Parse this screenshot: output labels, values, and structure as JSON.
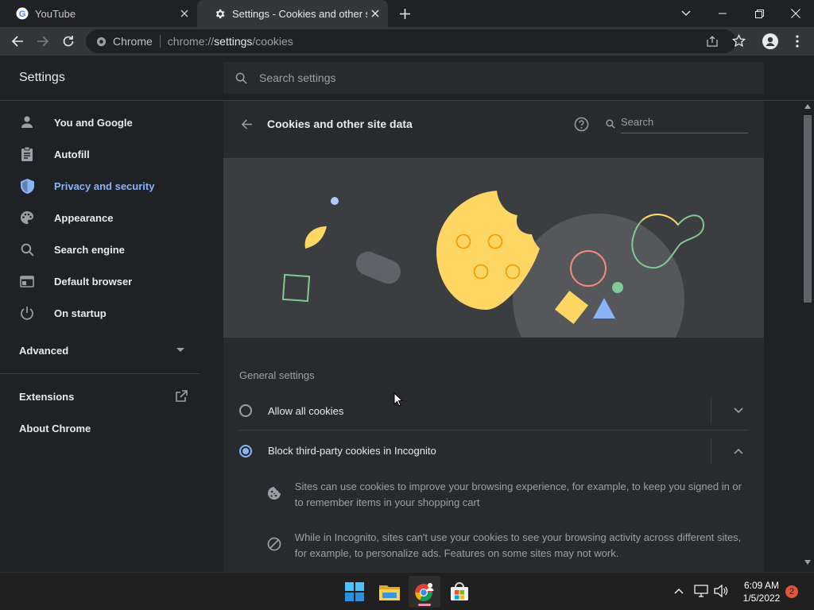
{
  "tabs": [
    {
      "title": "YouTube",
      "icon": "google-g-icon"
    },
    {
      "title": "Settings - Cookies and other site data",
      "icon": "gear-icon",
      "active": true
    }
  ],
  "toolbar": {
    "site_chip": "Chrome",
    "url_prefix": "chrome://",
    "url_host": "settings",
    "url_path": "/cookies"
  },
  "settings": {
    "title": "Settings",
    "search_placeholder": "Search settings"
  },
  "sidebar": {
    "items": [
      {
        "label": "You and Google",
        "icon": "person-icon"
      },
      {
        "label": "Autofill",
        "icon": "clipboard-icon"
      },
      {
        "label": "Privacy and security",
        "icon": "shield-icon",
        "active": true
      },
      {
        "label": "Appearance",
        "icon": "palette-icon"
      },
      {
        "label": "Search engine",
        "icon": "search-icon"
      },
      {
        "label": "Default browser",
        "icon": "browser-window-icon"
      },
      {
        "label": "On startup",
        "icon": "power-icon"
      }
    ],
    "advanced": "Advanced",
    "extensions": "Extensions",
    "about": "About Chrome"
  },
  "page": {
    "title": "Cookies and other site data",
    "search_placeholder": "Search",
    "section_title": "General settings",
    "options": [
      {
        "label": "Allow all cookies",
        "selected": false,
        "expanded": false
      },
      {
        "label": "Block third-party cookies in Incognito",
        "selected": true,
        "expanded": true
      }
    ],
    "details": [
      {
        "icon": "cookie-icon",
        "text": "Sites can use cookies to improve your browsing experience, for example, to keep you signed in or to remember items in your shopping cart"
      },
      {
        "icon": "block-icon",
        "text": "While in Incognito, sites can't use your cookies to see your browsing activity across different sites, for example, to personalize ads. Features on some sites may not work."
      }
    ]
  },
  "taskbar": {
    "time": "6:09 AM",
    "date": "1/5/2022",
    "notification_count": "2"
  },
  "colors": {
    "accent": "#8ab4f8",
    "background": "#202124",
    "card": "#292a2d",
    "cookie": "#fdd663"
  }
}
